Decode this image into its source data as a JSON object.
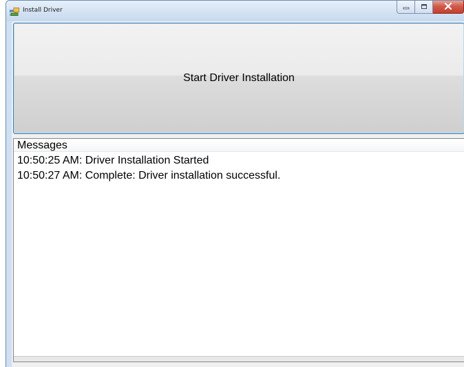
{
  "window": {
    "title": "Install Driver",
    "icons": {
      "app": "install-driver-app-icon",
      "minimize": "minimize-icon",
      "maximize": "maximize-icon",
      "close": "close-icon"
    }
  },
  "main": {
    "start_button_label": "Start Driver Installation"
  },
  "messages": {
    "header": "Messages",
    "items": [
      "10:50:25 AM: Driver Installation Started",
      "10:50:27 AM: Complete: Driver installation successful."
    ]
  },
  "colors": {
    "titlebar": "#d7e5f4",
    "close_button": "#c3402f",
    "button_focus_border": "#3c7fb1",
    "client_background": "#f0f0f0"
  }
}
